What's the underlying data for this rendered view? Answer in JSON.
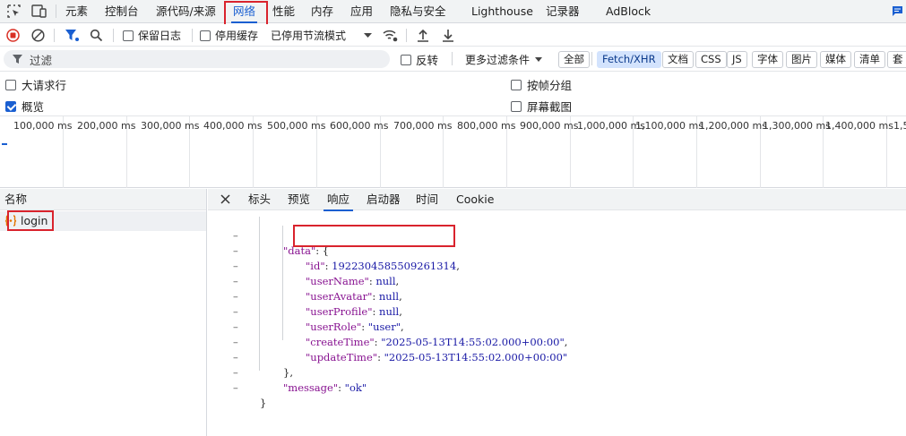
{
  "top_tabs": {
    "items": [
      {
        "label": "元素"
      },
      {
        "label": "控制台"
      },
      {
        "label": "源代码/来源"
      },
      {
        "label": "网络"
      },
      {
        "label": "性能"
      },
      {
        "label": "内存"
      },
      {
        "label": "应用"
      },
      {
        "label": "隐私与安全"
      },
      {
        "label": "Lighthouse"
      },
      {
        "label": "记录器"
      },
      {
        "label": "AdBlock"
      }
    ],
    "active": "网络",
    "icons": [
      "inspect-element-icon",
      "device-toolbar-icon",
      "feedback-icon"
    ]
  },
  "toolbar": {
    "preserve_log_label": "保留日志",
    "preserve_log_checked": false,
    "disable_cache_label": "停用缓存",
    "disable_cache_checked": false,
    "throttling_label": "已停用节流模式",
    "icons": [
      "record-stop-icon",
      "clear-icon",
      "filter-icon",
      "search-icon",
      "throttle-dropdown-icon",
      "network-conditions-icon",
      "import-har-icon",
      "export-har-icon"
    ]
  },
  "filter_row": {
    "placeholder": "过滤",
    "invert_label": "反转",
    "more_filters_label": "更多过滤条件",
    "chips": [
      "全部",
      "Fetch/XHR",
      "文档",
      "CSS",
      "JS",
      "字体",
      "图片",
      "媒体",
      "清单",
      "套"
    ],
    "active_chip": "Fetch/XHR"
  },
  "options": {
    "big_rows_label": "大请求行",
    "big_rows_checked": false,
    "overview_label": "概览",
    "overview_checked": true,
    "group_by_frame_label": "按帧分组",
    "group_by_frame_checked": false,
    "screenshots_label": "屏幕截图",
    "screenshots_checked": false
  },
  "timeline": {
    "ticks": [
      "100,000 ms",
      "200,000 ms",
      "300,000 ms",
      "400,000 ms",
      "500,000 ms",
      "600,000 ms",
      "700,000 ms",
      "800,000 ms",
      "900,000 ms",
      "1,000,000 ms",
      "1,100,000 ms",
      "1,200,000 ms",
      "1,300,000 ms",
      "1,400,000 ms",
      "1,5"
    ]
  },
  "requests": {
    "header": "名称",
    "items": [
      {
        "name": "login",
        "icon": "xhr-braces-icon"
      }
    ]
  },
  "detail": {
    "tabs": [
      "标头",
      "预览",
      "响应",
      "启动器",
      "时间",
      "Cookie"
    ],
    "active_tab": "响应"
  },
  "response": {
    "lines": [
      {
        "indent": 0,
        "key": "\"data\"",
        "rest": ": {"
      },
      {
        "indent": 1,
        "key": "\"id\"",
        "rest": ": ",
        "value": "1922304585509261314",
        "tail": ","
      },
      {
        "indent": 1,
        "key": "\"userName\"",
        "rest": ": ",
        "value": "null",
        "tail": ","
      },
      {
        "indent": 1,
        "key": "\"userAvatar\"",
        "rest": ": ",
        "value": "null",
        "tail": ","
      },
      {
        "indent": 1,
        "key": "\"userProfile\"",
        "rest": ": ",
        "value": "null",
        "tail": ","
      },
      {
        "indent": 1,
        "key": "\"userRole\"",
        "rest": ": ",
        "value": "\"user\"",
        "tail": ","
      },
      {
        "indent": 1,
        "key": "\"createTime\"",
        "rest": ": ",
        "value": "\"2025-05-13T14:55:02.000+00:00\"",
        "tail": ","
      },
      {
        "indent": 1,
        "key": "\"updateTime\"",
        "rest": ": ",
        "value": "\"2025-05-13T14:55:02.000+00:00\"",
        "tail": ""
      },
      {
        "indent": 0,
        "key": "",
        "rest": "},"
      },
      {
        "indent": 0,
        "key": "\"message\"",
        "rest": ": ",
        "value": "\"ok\"",
        "tail": ""
      },
      {
        "indent": -1,
        "key": "",
        "rest": "}"
      }
    ]
  },
  "colors": {
    "accent": "#1a5fd1",
    "highlight_box": "#d9232d",
    "json_key": "#881391",
    "json_value": "#1a1aa6"
  }
}
